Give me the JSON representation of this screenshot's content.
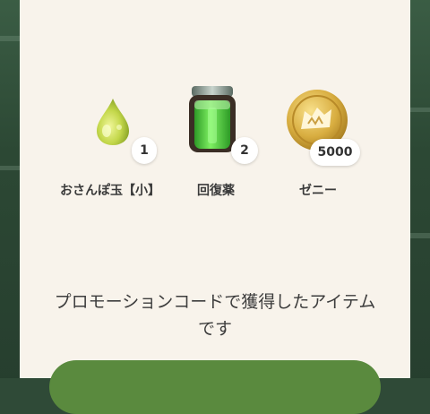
{
  "rewards": [
    {
      "name": "おさんぽ玉【小】",
      "quantity": "1",
      "icon": "green-drop-icon"
    },
    {
      "name": "回復薬",
      "quantity": "2",
      "icon": "potion-jar-icon"
    },
    {
      "name": "ゼニー",
      "quantity": "5000",
      "icon": "zenny-coin-icon"
    }
  ],
  "message_line1": "プロモーションコードで獲得したアイテム",
  "message_line2": "です",
  "colors": {
    "panel": "#f8f3eb",
    "button": "#5a8a3e",
    "coin": "#d9b24a",
    "potion": "#46c83a"
  }
}
